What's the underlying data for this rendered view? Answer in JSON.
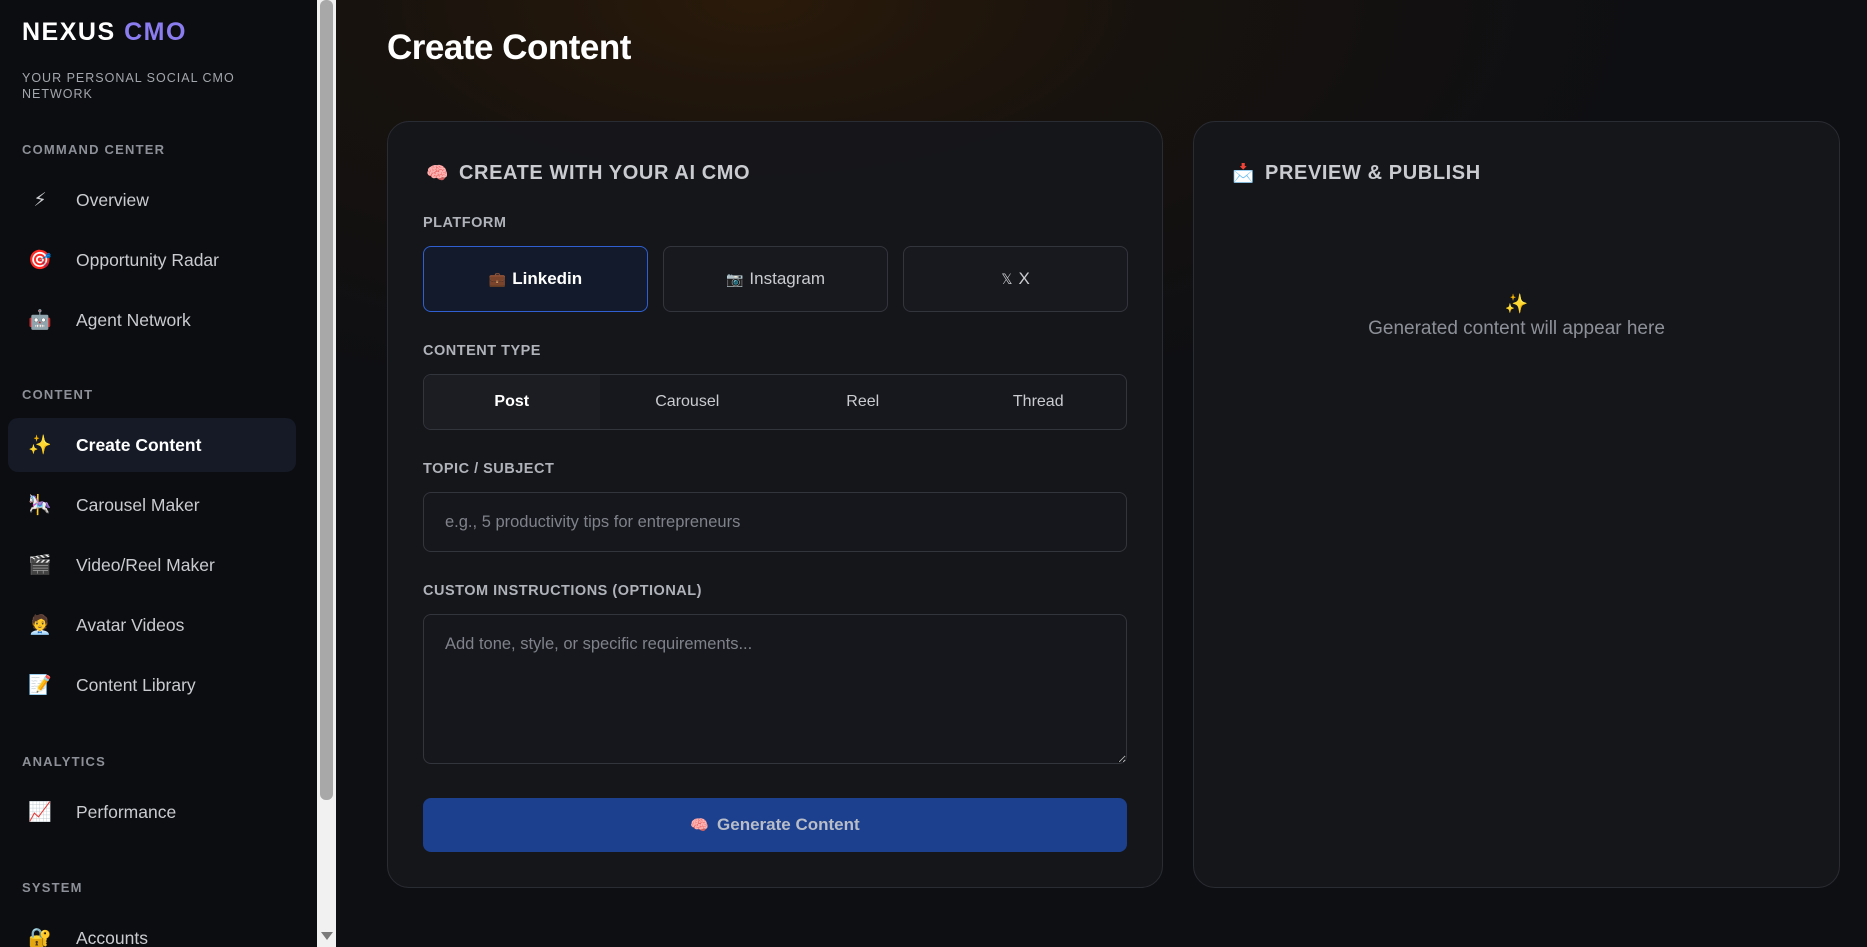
{
  "sidebar": {
    "brand": {
      "primary": "NEXUS",
      "accent": "CMO"
    },
    "tagline": "YOUR PERSONAL SOCIAL CMO NETWORK",
    "sections": {
      "command_center": "COMMAND CENTER",
      "content": "CONTENT",
      "analytics": "ANALYTICS",
      "system": "SYSTEM"
    },
    "items": {
      "overview": {
        "label": "Overview",
        "icon": "⚡"
      },
      "opportunity_radar": {
        "label": "Opportunity Radar",
        "icon": "🎯"
      },
      "agent_network": {
        "label": "Agent Network",
        "icon": "🤖"
      },
      "create_content": {
        "label": "Create Content",
        "icon": "✨"
      },
      "carousel_maker": {
        "label": "Carousel Maker",
        "icon": "🎠"
      },
      "video_reel_maker": {
        "label": "Video/Reel Maker",
        "icon": "🎬"
      },
      "avatar_videos": {
        "label": "Avatar Videos",
        "icon": "🧑‍💼"
      },
      "content_library": {
        "label": "Content Library",
        "icon": "📝"
      },
      "performance": {
        "label": "Performance",
        "icon": "📈"
      },
      "accounts": {
        "label": "Accounts",
        "icon": "🔐"
      }
    },
    "active_item": "create_content"
  },
  "main": {
    "page_title": "Create Content",
    "create_card": {
      "title": "CREATE WITH YOUR AI CMO",
      "title_icon": "🧠",
      "platform_label": "PLATFORM",
      "platforms": {
        "linkedin": {
          "label": "Linkedin",
          "icon": "💼"
        },
        "instagram": {
          "label": "Instagram",
          "icon": "📷"
        },
        "x": {
          "label": "X",
          "icon": "𝕏"
        }
      },
      "selected_platform": "linkedin",
      "content_type_label": "CONTENT TYPE",
      "content_types": {
        "post": "Post",
        "carousel": "Carousel",
        "reel": "Reel",
        "thread": "Thread"
      },
      "selected_content_type": "post",
      "topic_label": "TOPIC / SUBJECT",
      "topic_value": "",
      "topic_placeholder": "e.g., 5 productivity tips for entrepreneurs",
      "instructions_label": "CUSTOM INSTRUCTIONS (OPTIONAL)",
      "instructions_value": "",
      "instructions_placeholder": "Add tone, style, or specific requirements...",
      "generate_label": "Generate Content",
      "generate_icon": "🧠"
    },
    "preview_card": {
      "title": "PREVIEW & PUBLISH",
      "title_icon": "📩",
      "empty_icon": "✨",
      "empty_message": "Generated content will appear here"
    }
  },
  "colors": {
    "brand_accent": "#8b7cf0",
    "primary_button": "#1c3f8e",
    "selected_border": "#2f5fd0"
  }
}
